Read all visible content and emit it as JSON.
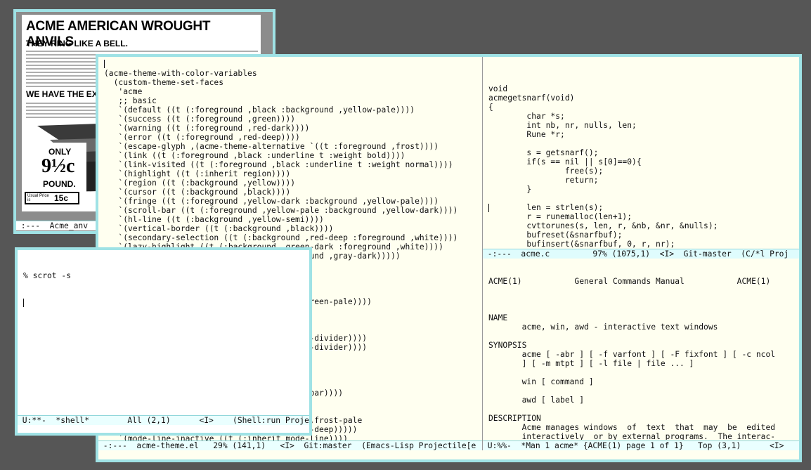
{
  "colors": {
    "desktop": "#565656",
    "window_border": "#9fe2e5",
    "editor_bg": "#fffff0",
    "modeline_bg": "#eaffff"
  },
  "image_window": {
    "ad_description": "Acme American Wrought Anvils newspaper advertisement",
    "ad_title": "ACME AMERICAN WROUGHT ANVILS",
    "headline": "THEY RING LIKE A BELL.",
    "sub_headline": "WE HAVE THE EXC",
    "price_only": "ONLY",
    "price_value": "9½c",
    "price_unit": "POUND.",
    "usual_price_label": "Usual Price is",
    "usual_price_value": "15c",
    "modeline": " :---  Acme_anv"
  },
  "emacs": {
    "left_buffer": {
      "lines": [
        "(acme-theme-with-color-variables",
        "  (custom-theme-set-faces",
        "   'acme",
        "   ;; basic",
        "   `(default ((t (:foreground ,black :background ,yellow-pale))))",
        "   `(success ((t (:foreground ,green))))",
        "   `(warning ((t (:foreground ,red-dark))))",
        "   `(error ((t (:foreground ,red-deep))))",
        "   `(escape-glyph ,(acme-theme-alternative `((t :foreground ,frost))))",
        "   `(link ((t (:foreground ,black :underline t :weight bold))))",
        "   `(link-visited ((t (:foreground ,black :underline t :weight normal))))",
        "   `(highlight ((t (:inherit region))))",
        "   `(region ((t (:background ,yellow))))",
        "   `(cursor ((t (:background ,black))))",
        "   `(fringe ((t (:foreground ,yellow-dark :background ,yellow-pale))))",
        "   `(scroll-bar ((t (:foreground ,yellow-pale :background ,yellow-dark))))",
        "   `(hl-line ((t (:background ,yellow-semi))))",
        "   `(vertical-border ((t (:background ,black))))",
        "   `(secondary-selection ((t (:background ,red-deep :foreground ,white))))",
        "   `(lazy-highlight ((t (:background ,green-dark :foreground ,white))))",
        "                                  (:foreground ,gray-dark)))))",
        "",
        "",
        "",
        "",
        "                                  ground ,green-pale))))",
        "",
        "",
        "                                  )))",
        "                                  it window-divider))))",
        "                                  it window-divider))))",
        "",
        "",
        "",
        "",
        "                                  t scroll-bar))))",
        "",
        "",
        "                                  ckground ,frost-pale",
        "                                  or ,frost-deep)))))",
        "   `(mode-line-inactive ((t (:inherit mode-line))))"
      ],
      "modeline": " -:---  acme-theme.el   29% (141,1)   <I>  Git:master  (Emacs-Lisp Projectile[e"
    },
    "right_top_buffer": {
      "lines": [
        "void",
        "acmegetsnarf(void)",
        "{",
        "        char *s;",
        "        int nb, nr, nulls, len;",
        "        Rune *r;",
        "",
        "        s = getsnarf();",
        "        if(s == nil || s[0]==0){",
        "                free(s);",
        "                return;",
        "        }",
        "",
        "        len = strlen(s);",
        "        r = runemalloc(len+1);",
        "        cvttorunes(s, len, r, &nb, &nr, &nulls);",
        "        bufreset(&snarfbuf);",
        "        bufinsert(&snarfbuf, 0, r, nr);",
        "        free(r);",
        "        free(s);"
      ],
      "modeline": " -:---  acme.c         97% (1075,1)  <I>  Git-master  (C/*l Proj"
    },
    "right_bottom_buffer": {
      "header": "ACME(1)           General Commands Manual           ACME(1)",
      "lines": [
        "",
        "NAME",
        "       acme, win, awd - interactive text windows",
        "",
        "SYNOPSIS",
        "       acme [ -abr ] [ -f varfont ] [ -F fixfont ] [ -c ncol",
        "       ] [ -m mtpt ] [ -l file | file ... ]",
        "",
        "       win [ command ]",
        "",
        "       awd [ label ]",
        "",
        "DESCRIPTION",
        "       Acme manages windows  of  text  that  may  be  edited",
        "       interactively  or by external programs.  The interac-",
        "       tive interface uses the keyboard and mouse;  external",
        "       programs use a set of files served by acme; these are",
        "       discussed in acme(4)."
      ],
      "modeline": " U:%%-  *Man 1 acme* {ACME(1) page 1 of 1}   Top (3,1)      <I>"
    }
  },
  "shell": {
    "prompt_line": "% scrot -s",
    "modeline": " U:**-  *shell*        All (2,1)      <I>    (Shell:run Proje"
  }
}
